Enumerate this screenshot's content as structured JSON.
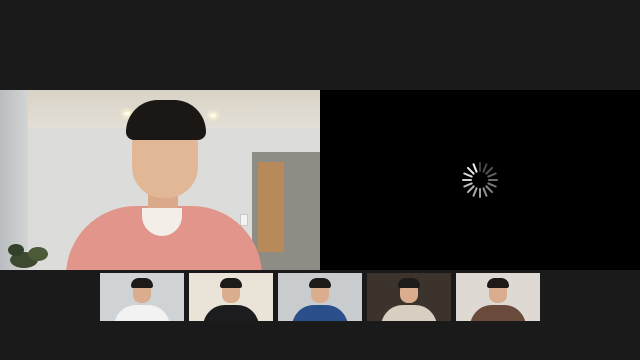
{
  "app": {
    "name": "video-conference"
  },
  "stage": {
    "active_speaker": {
      "icon": "participant-video",
      "shirt_color": "#e2958a"
    },
    "loading_tile": {
      "icon": "loading-spinner-icon",
      "background": "#000000"
    }
  },
  "thumbnails": [
    {
      "icon": "participant-video",
      "background": "#cfd3d6",
      "shirt_color": "#f2f2f2"
    },
    {
      "icon": "participant-video",
      "background": "#e9e3d8",
      "shirt_color": "#1d1d1f"
    },
    {
      "icon": "participant-video",
      "background": "#c9ccce",
      "shirt_color": "#2a4f8a"
    },
    {
      "icon": "participant-video",
      "background": "#3b332c",
      "shirt_color": "#d8cfc2"
    },
    {
      "icon": "participant-video",
      "background": "#dedad3",
      "shirt_color": "#6a4a3a"
    }
  ],
  "colors": {
    "app_background": "#1a1a1a"
  }
}
